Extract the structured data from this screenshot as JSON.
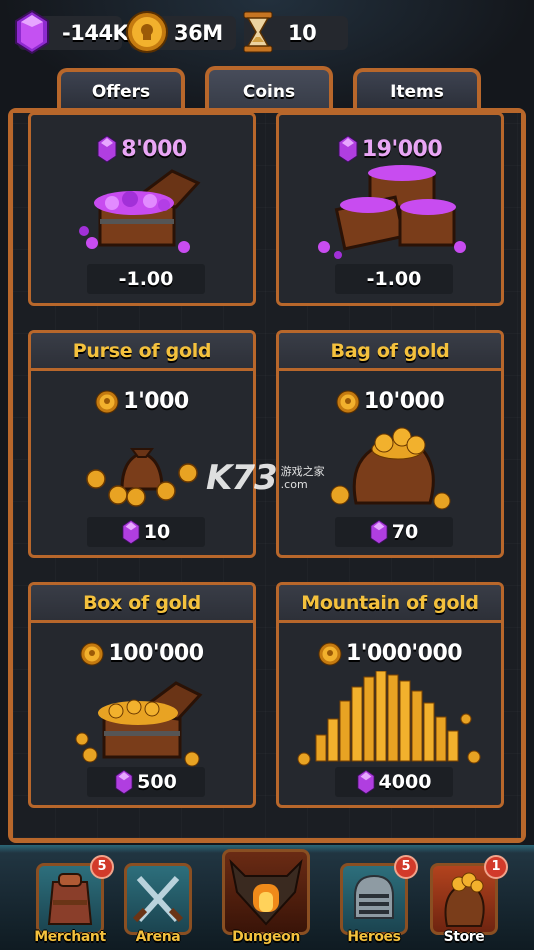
{
  "resources": {
    "gems": "-144K",
    "gold": "36M",
    "hourglass": "10"
  },
  "tabs": [
    {
      "label": "Offers",
      "active": false
    },
    {
      "label": "Coins",
      "active": true
    },
    {
      "label": "Items",
      "active": false
    }
  ],
  "store_items": [
    {
      "title": "",
      "amount": "8'000",
      "currency": "gem",
      "price": "-1.00",
      "price_currency": ""
    },
    {
      "title": "",
      "amount": "19'000",
      "currency": "gem",
      "price": "-1.00",
      "price_currency": ""
    },
    {
      "title": "Purse of gold",
      "amount": "1'000",
      "currency": "coin",
      "price": "10",
      "price_currency": "gem"
    },
    {
      "title": "Bag of gold",
      "amount": "10'000",
      "currency": "coin",
      "price": "70",
      "price_currency": "gem"
    },
    {
      "title": "Box of gold",
      "amount": "100'000",
      "currency": "coin",
      "price": "500",
      "price_currency": "gem"
    },
    {
      "title": "Mountain of gold",
      "amount": "1'000'000",
      "currency": "coin",
      "price": "4000",
      "price_currency": "gem"
    }
  ],
  "watermark": {
    "logo": "K73",
    "line1": "游戏之家",
    "line2": ".com"
  },
  "nav": [
    {
      "label": "Merchant",
      "badge": "5"
    },
    {
      "label": "Arena",
      "badge": ""
    },
    {
      "label": "Dungeon",
      "badge": ""
    },
    {
      "label": "Heroes",
      "badge": "5"
    },
    {
      "label": "Store",
      "badge": "1"
    }
  ],
  "colors": {
    "frame": "#b8672b",
    "title_gold": "#f4c13d",
    "gem_purple": "#b03ee0",
    "coin_gold": "#e8a323",
    "badge_red": "#d23a2a"
  }
}
